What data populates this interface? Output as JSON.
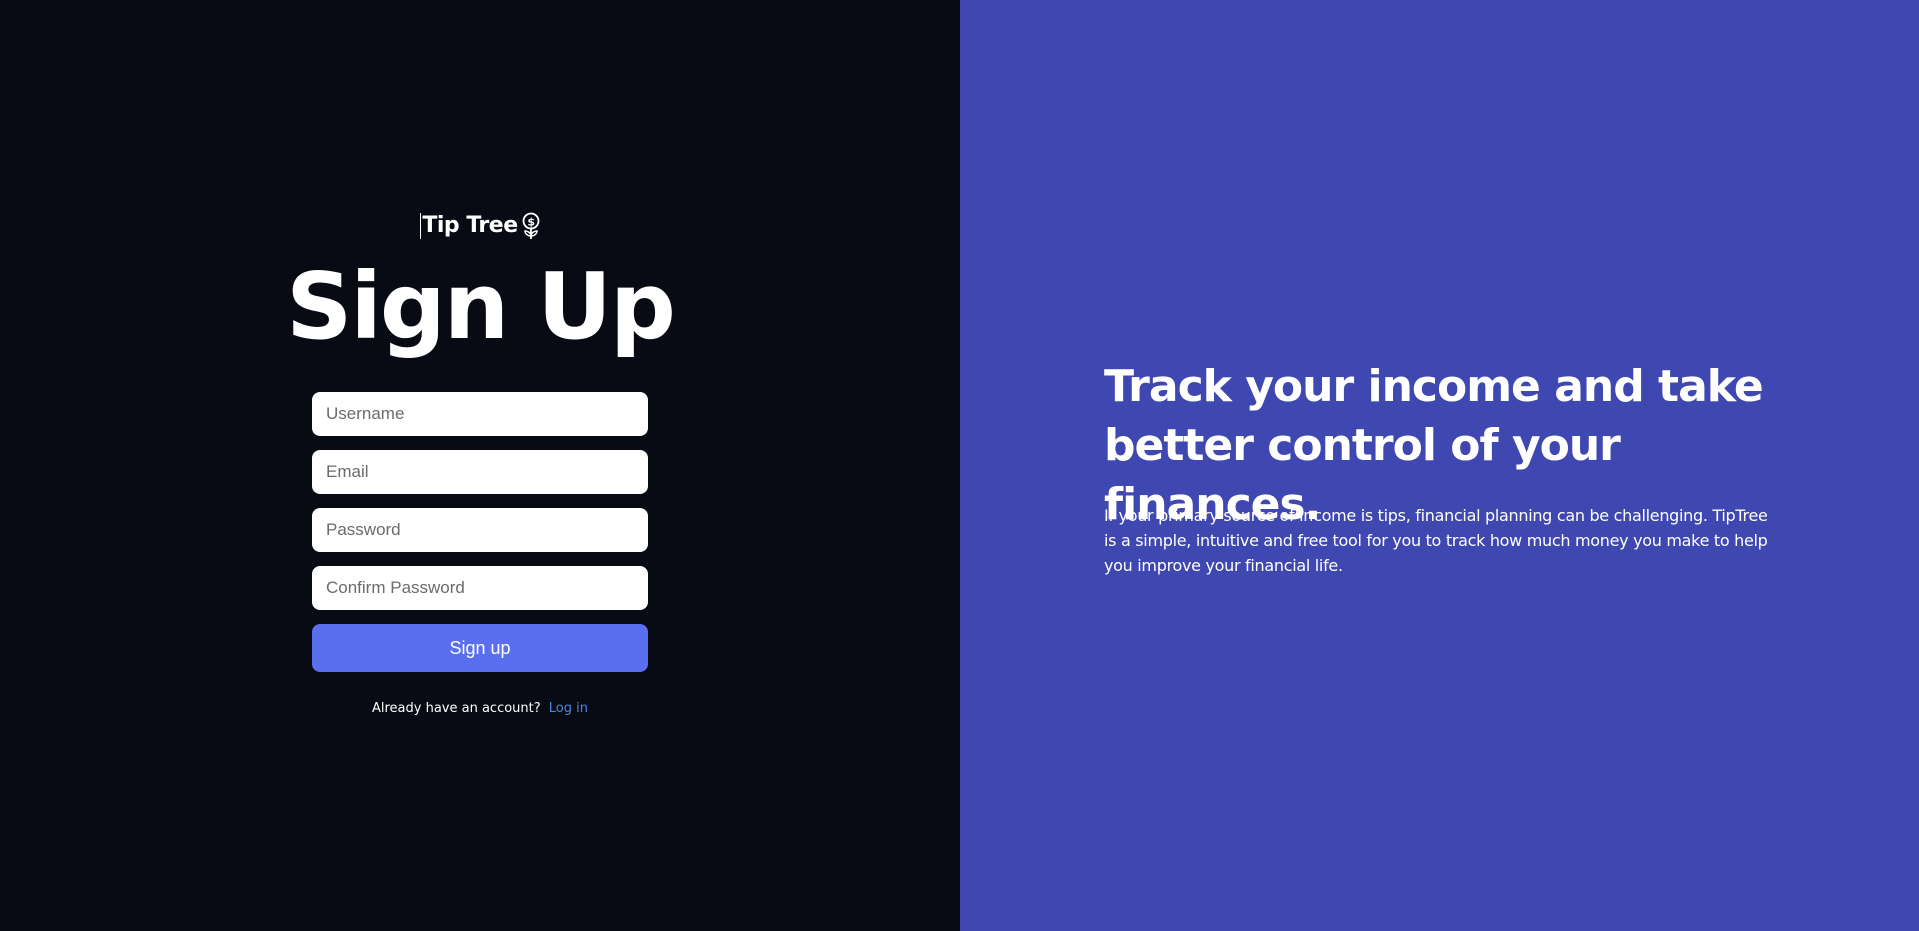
{
  "brand": {
    "name": "Tip Tree",
    "icon": "flower-dollar-icon"
  },
  "form": {
    "title": "Sign Up",
    "username_placeholder": "Username",
    "email_placeholder": "Email",
    "password_placeholder": "Password",
    "confirm_password_placeholder": "Confirm Password",
    "submit_label": "Sign up",
    "login_prompt": "Already have an account?",
    "login_link": "Log in"
  },
  "promo": {
    "headline": "Track your income and take better control of your finances.",
    "body": "If your primary source of income is tips, financial planning can be challenging. TipTree is a simple, intuitive and free tool for you to track how much money you make to help you improve your financial life."
  },
  "colors": {
    "left_background": "#080b13",
    "right_background": "#3f47b0",
    "button": "#5a6ff0",
    "link": "#4c86e0"
  }
}
